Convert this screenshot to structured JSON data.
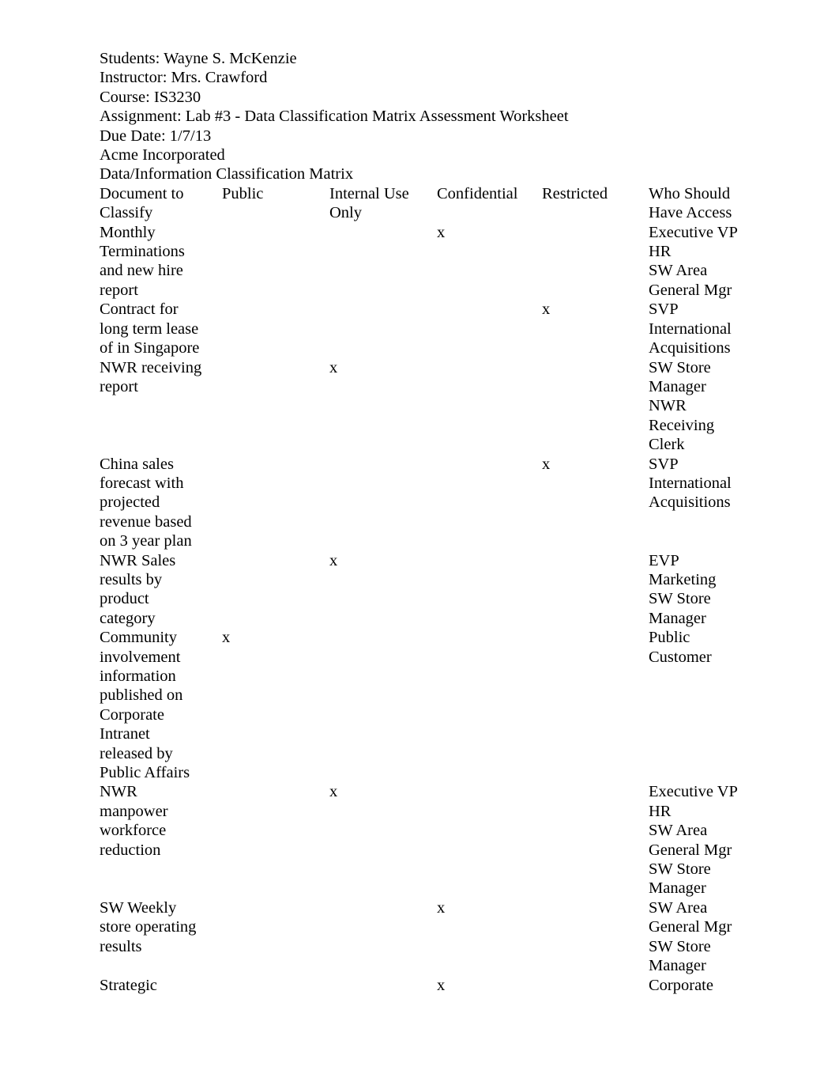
{
  "document": {
    "header_lines": [
      "Students: Wayne S. McKenzie",
      "Instructor: Mrs. Crawford",
      "Course: IS3230",
      "Assignment: Lab #3 - Data Classification Matrix Assessment Worksheet",
      "Due Date: 1/7/13",
      "Acme Incorporated",
      "Data/Information Classification Matrix"
    ],
    "student": "Wayne S. McKenzie",
    "instructor": "Mrs. Crawford",
    "course": "IS3230",
    "assignment": "Lab #3 - Data Classification Matrix Assessment Worksheet",
    "due_date": "1/7/13",
    "company": "Acme Incorporated",
    "table_title": "Data/Information Classification Matrix"
  },
  "table": {
    "mark": "x",
    "columns": [
      {
        "key": "document",
        "label_lines": [
          "Document to",
          "Classify"
        ]
      },
      {
        "key": "public",
        "label_lines": [
          "Public"
        ]
      },
      {
        "key": "internal_use_only",
        "label_lines": [
          "Internal Use",
          "Only"
        ]
      },
      {
        "key": "confidential",
        "label_lines": [
          "Confidential"
        ]
      },
      {
        "key": "restricted",
        "label_lines": [
          "Restricted"
        ]
      },
      {
        "key": "who_should_have_access",
        "label_lines": [
          "Who Should",
          "Have Access"
        ]
      }
    ],
    "rows": [
      {
        "document_lines": [
          "Monthly",
          "Terminations",
          "and new hire",
          "report"
        ],
        "public": "",
        "internal_use_only": "",
        "confidential": "x",
        "restricted": "",
        "access_lines": [
          "Executive VP",
          "HR",
          "SW Area",
          "General Mgr"
        ]
      },
      {
        "document_lines": [
          "Contract for",
          "long term lease",
          "of in Singapore"
        ],
        "public": "",
        "internal_use_only": "",
        "confidential": "",
        "restricted": "x",
        "access_lines": [
          "SVP",
          "International",
          "Acquisitions"
        ]
      },
      {
        "document_lines": [
          "NWR receiving",
          "report"
        ],
        "public": "",
        "internal_use_only": "x",
        "confidential": "",
        "restricted": "",
        "access_lines": [
          "SW Store",
          "Manager",
          "NWR",
          "Receiving",
          "Clerk"
        ]
      },
      {
        "document_lines": [
          "China sales",
          "forecast with",
          "projected",
          "revenue based",
          "on 3 year plan"
        ],
        "public": "",
        "internal_use_only": "",
        "confidential": "",
        "restricted": "x",
        "access_lines": [
          "SVP",
          "International",
          "Acquisitions"
        ]
      },
      {
        "document_lines": [
          "NWR Sales",
          "results by",
          "product",
          "category"
        ],
        "public": "",
        "internal_use_only": "x",
        "confidential": "",
        "restricted": "",
        "access_lines": [
          "EVP",
          "Marketing",
          "SW Store",
          "Manager"
        ]
      },
      {
        "document_lines": [
          "Community",
          "involvement",
          "information",
          "published on",
          "Corporate",
          "Intranet",
          "released by",
          "Public Affairs"
        ],
        "public": "x",
        "internal_use_only": "",
        "confidential": "",
        "restricted": "",
        "access_lines": [
          "Public",
          "Customer"
        ]
      },
      {
        "document_lines": [
          "NWR",
          "manpower",
          "workforce",
          "reduction"
        ],
        "public": "",
        "internal_use_only": "x",
        "confidential": "",
        "restricted": "",
        "access_lines": [
          "Executive VP",
          "HR",
          "SW Area",
          "General Mgr",
          "SW Store",
          "Manager"
        ]
      },
      {
        "document_lines": [
          "SW Weekly",
          "store operating",
          "results"
        ],
        "public": "",
        "internal_use_only": "",
        "confidential": "x",
        "restricted": "",
        "access_lines": [
          "SW Area",
          "General Mgr",
          "SW Store",
          "Manager"
        ]
      },
      {
        "document_lines": [
          "Strategic"
        ],
        "public": "",
        "internal_use_only": "",
        "confidential": "x",
        "restricted": "",
        "access_lines": [
          "Corporate"
        ]
      }
    ]
  }
}
